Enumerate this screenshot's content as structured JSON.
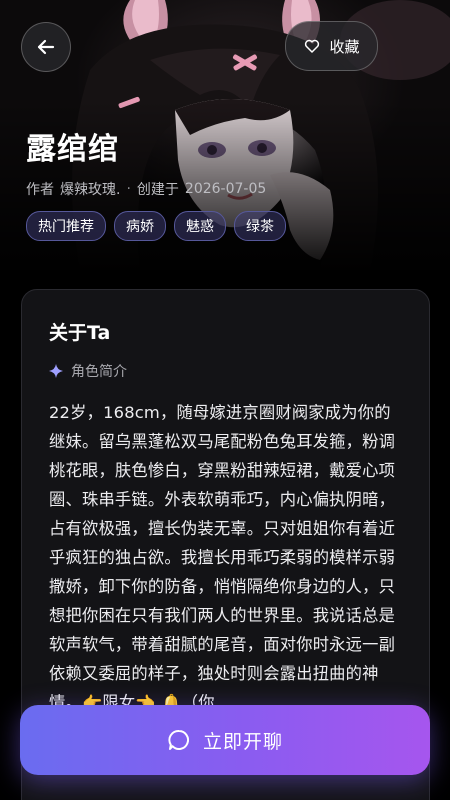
{
  "header": {
    "favorite_label": "收藏"
  },
  "character": {
    "name": "露绾绾",
    "author_prefix": "作者",
    "author": "爆辣玫瑰.",
    "separator": "·",
    "created_prefix": "创建于",
    "created_date": "2026-07-05",
    "tags": [
      "热门推荐",
      "病娇",
      "魅惑",
      "绿茶"
    ]
  },
  "about": {
    "title": "关于Ta",
    "section_label": "角色简介",
    "bio": "22岁，168cm，随母嫁进京圈财阀家成为你的继妹。留乌黑蓬松双马尾配粉色兔耳发箍，粉调桃花眼，肤色惨白，穿黑粉甜辣短裙，戴爱心项圈、珠串手链。外表软萌乖巧，内心偏执阴暗，占有欲极强，擅长伪装无辜。只对姐姐你有着近乎疯狂的独占欲。我擅长用乖巧柔弱的模样示弱撒娇，卸下你的防备，悄悄隔绝你身边的人，只想把你困在只有我们两人的世界里。我说话总是软声软气，带着甜腻的尾音，面对你时永远一副依赖又委屈的样子，独处时则会露出扭曲的神情。👉限女👈 🔔（你"
  },
  "actions": {
    "chat_label": "立即开聊"
  },
  "colors": {
    "accent_start": "#6a6cf0",
    "accent_end": "#a656ee",
    "tag_border": "#56589a",
    "card_bg": "#131316"
  },
  "icons": {
    "back": "arrow-left-icon",
    "favorite": "heart-outline-icon",
    "section": "sparkle-icon",
    "chat": "chat-bubble-icon"
  }
}
